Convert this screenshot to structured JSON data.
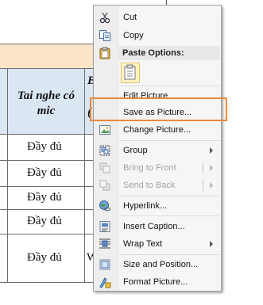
{
  "table": {
    "header_cell": "Tai nghe có mic",
    "header_partial": "B",
    "header_partial2": "(",
    "rows": [
      {
        "value": "Đầy đủ"
      },
      {
        "value": "Đầy đủ"
      },
      {
        "value": "Đầy đủ"
      },
      {
        "value": "Đầy đủ"
      },
      {
        "value": "Đầy đủ",
        "extra": "W"
      }
    ]
  },
  "context_menu": {
    "items": {
      "cut": "Cut",
      "copy": "Copy",
      "paste_options": "Paste Options:",
      "edit_picture": "Edit Picture",
      "save_as_picture": "Save as Picture...",
      "change_picture": "Change Picture...",
      "group": "Group",
      "bring_to_front": "Bring to Front",
      "send_to_back": "Send to Back",
      "hyperlink": "Hyperlink...",
      "insert_caption": "Insert Caption...",
      "wrap_text": "Wrap Text",
      "size_and_position": "Size and Position...",
      "format_picture": "Format Picture..."
    }
  },
  "colors": {
    "highlight": "#ea8a3b",
    "header_band": "#fbe5c9",
    "header_bg": "#dbe6f3"
  }
}
